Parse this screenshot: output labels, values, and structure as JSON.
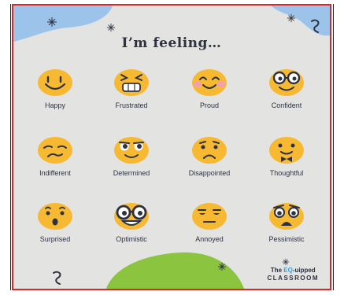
{
  "title": "I’m feeling…",
  "colors": {
    "background": "#e3e3e1",
    "frame": "#d62a2a",
    "face": "#f6b931",
    "blob_blue": "#9cc4ea",
    "blob_green": "#8bc43f",
    "ink": "#2d3140"
  },
  "emotions": [
    {
      "label": "Happy",
      "icon": "happy-face-icon"
    },
    {
      "label": "Frustrated",
      "icon": "frustrated-face-icon"
    },
    {
      "label": "Proud",
      "icon": "proud-face-icon"
    },
    {
      "label": "Confident",
      "icon": "confident-face-icon"
    },
    {
      "label": "Indifferent",
      "icon": "indifferent-face-icon"
    },
    {
      "label": "Determined",
      "icon": "determined-face-icon"
    },
    {
      "label": "Disappointed",
      "icon": "disappointed-face-icon"
    },
    {
      "label": "Thoughtful",
      "icon": "thoughtful-face-icon"
    },
    {
      "label": "Surprised",
      "icon": "surprised-face-icon"
    },
    {
      "label": "Optimistic",
      "icon": "optimistic-face-icon"
    },
    {
      "label": "Annoyed",
      "icon": "annoyed-face-icon"
    },
    {
      "label": "Pessimistic",
      "icon": "pessimistic-face-icon"
    }
  ],
  "brand": {
    "line1_prefix": "The ",
    "line1_highlight": "EQ",
    "line1_suffix": "-uipped",
    "line2": "CLASSROOM"
  }
}
